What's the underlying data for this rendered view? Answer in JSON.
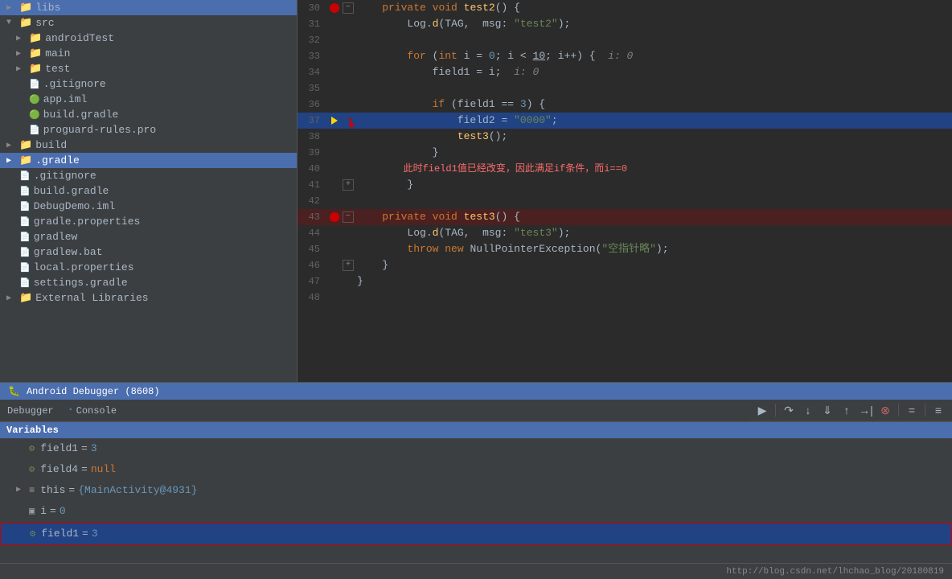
{
  "sidebar": {
    "items": [
      {
        "label": "libs",
        "indent": 0,
        "type": "folder",
        "collapsed": true
      },
      {
        "label": "src",
        "indent": 0,
        "type": "folder",
        "collapsed": false
      },
      {
        "label": "androidTest",
        "indent": 1,
        "type": "folder",
        "collapsed": true
      },
      {
        "label": "main",
        "indent": 1,
        "type": "folder",
        "collapsed": true
      },
      {
        "label": "test",
        "indent": 1,
        "type": "folder",
        "collapsed": true
      },
      {
        "label": ".gitignore",
        "indent": 1,
        "type": "file-git"
      },
      {
        "label": "app.iml",
        "indent": 1,
        "type": "file-iml"
      },
      {
        "label": "build.gradle",
        "indent": 1,
        "type": "file-gradle"
      },
      {
        "label": "proguard-rules.pro",
        "indent": 1,
        "type": "file"
      },
      {
        "label": "build",
        "indent": 0,
        "type": "folder"
      },
      {
        "label": ".gradle",
        "indent": 0,
        "type": "folder",
        "active": true
      },
      {
        "label": ".gitignore",
        "indent": 0,
        "type": "file"
      },
      {
        "label": "build.gradle",
        "indent": 0,
        "type": "file"
      },
      {
        "label": "DebugDemo.iml",
        "indent": 0,
        "type": "file"
      },
      {
        "label": "gradle.properties",
        "indent": 0,
        "type": "file"
      },
      {
        "label": "gradlew",
        "indent": 0,
        "type": "file"
      },
      {
        "label": "gradlew.bat",
        "indent": 0,
        "type": "file"
      },
      {
        "label": "local.properties",
        "indent": 0,
        "type": "file"
      },
      {
        "label": "settings.gradle",
        "indent": 0,
        "type": "file"
      },
      {
        "label": "External Libraries",
        "indent": 0,
        "type": "folder"
      }
    ]
  },
  "code": {
    "lines": [
      {
        "num": 30,
        "content": "    private void test2() {",
        "breakpoint": "active",
        "foldable": true
      },
      {
        "num": 31,
        "content": "        Log.d(TAG,  msg: \"test2\");",
        "breakpoint": false
      },
      {
        "num": 32,
        "content": "",
        "breakpoint": false
      },
      {
        "num": 33,
        "content": "        for (int i = 0; i < 10; i++) {  i: 0",
        "breakpoint": false,
        "foldable": false,
        "italic_suffix": "i: 0"
      },
      {
        "num": 34,
        "content": "            field1 = i;  i: 0",
        "breakpoint": false,
        "italic_suffix": "i: 0"
      },
      {
        "num": 35,
        "content": "",
        "breakpoint": false
      },
      {
        "num": 36,
        "content": "            if (field1 == 3) {",
        "breakpoint": false
      },
      {
        "num": 37,
        "content": "                field2 = \"0000\";",
        "breakpoint": false,
        "highlighted": true
      },
      {
        "num": 38,
        "content": "                test3();",
        "breakpoint": false
      },
      {
        "num": 39,
        "content": "            }",
        "breakpoint": false
      },
      {
        "num": 40,
        "content": "        此时field1值已经改变，因此满足if条件，而i==0",
        "breakpoint": false,
        "comment": true
      },
      {
        "num": 41,
        "content": "        }",
        "breakpoint": false,
        "foldable": false
      },
      {
        "num": 42,
        "content": "",
        "breakpoint": false
      },
      {
        "num": 43,
        "content": "    private void test3() {",
        "breakpoint": "active",
        "error": true,
        "foldable": true
      },
      {
        "num": 44,
        "content": "        Log.d(TAG,  msg: \"test3\");",
        "breakpoint": false
      },
      {
        "num": 45,
        "content": "        throw new NullPointerException(\"空指针略\");",
        "breakpoint": false
      },
      {
        "num": 46,
        "content": "    }",
        "breakpoint": false,
        "foldable": false
      },
      {
        "num": 47,
        "content": "}",
        "breakpoint": false
      },
      {
        "num": 48,
        "content": "",
        "breakpoint": false
      }
    ]
  },
  "debugger": {
    "title": "Android Debugger (8608)",
    "tabs": [
      {
        "label": "Debugger",
        "active": false
      },
      {
        "label": "Console",
        "active": false
      }
    ],
    "toolbar_buttons": [
      {
        "icon": "↷",
        "tooltip": "Step Over"
      },
      {
        "icon": "↓",
        "tooltip": "Step Into"
      },
      {
        "icon": "⇣",
        "tooltip": "Force Step Into"
      },
      {
        "icon": "↑",
        "tooltip": "Step Out"
      },
      {
        "icon": "→",
        "tooltip": "Run to Cursor"
      },
      {
        "icon": "⊗",
        "tooltip": "Stop"
      },
      {
        "icon": "⊕",
        "tooltip": "Evaluate Expression"
      },
      {
        "icon": "≡",
        "tooltip": "Frames"
      }
    ],
    "variables_header": "Variables",
    "variables": [
      {
        "name": "field1",
        "value": "3",
        "type": "int",
        "icon": "🔵",
        "indent": 0
      },
      {
        "name": "field4",
        "value": "null",
        "type": "null",
        "icon": "🔵",
        "indent": 0
      },
      {
        "name": "this",
        "value": "{MainActivity@4931}",
        "type": "object",
        "icon": "📦",
        "indent": 0,
        "expandable": true
      },
      {
        "name": "i",
        "value": "0",
        "type": "int",
        "icon": "📋",
        "indent": 0
      },
      {
        "name": "field1",
        "value": "3",
        "type": "int",
        "icon": "🔵",
        "indent": 0,
        "highlighted": true
      }
    ]
  },
  "status_bar": {
    "url": "http://blog.csdn.net/lhchao_blog/20180819"
  }
}
